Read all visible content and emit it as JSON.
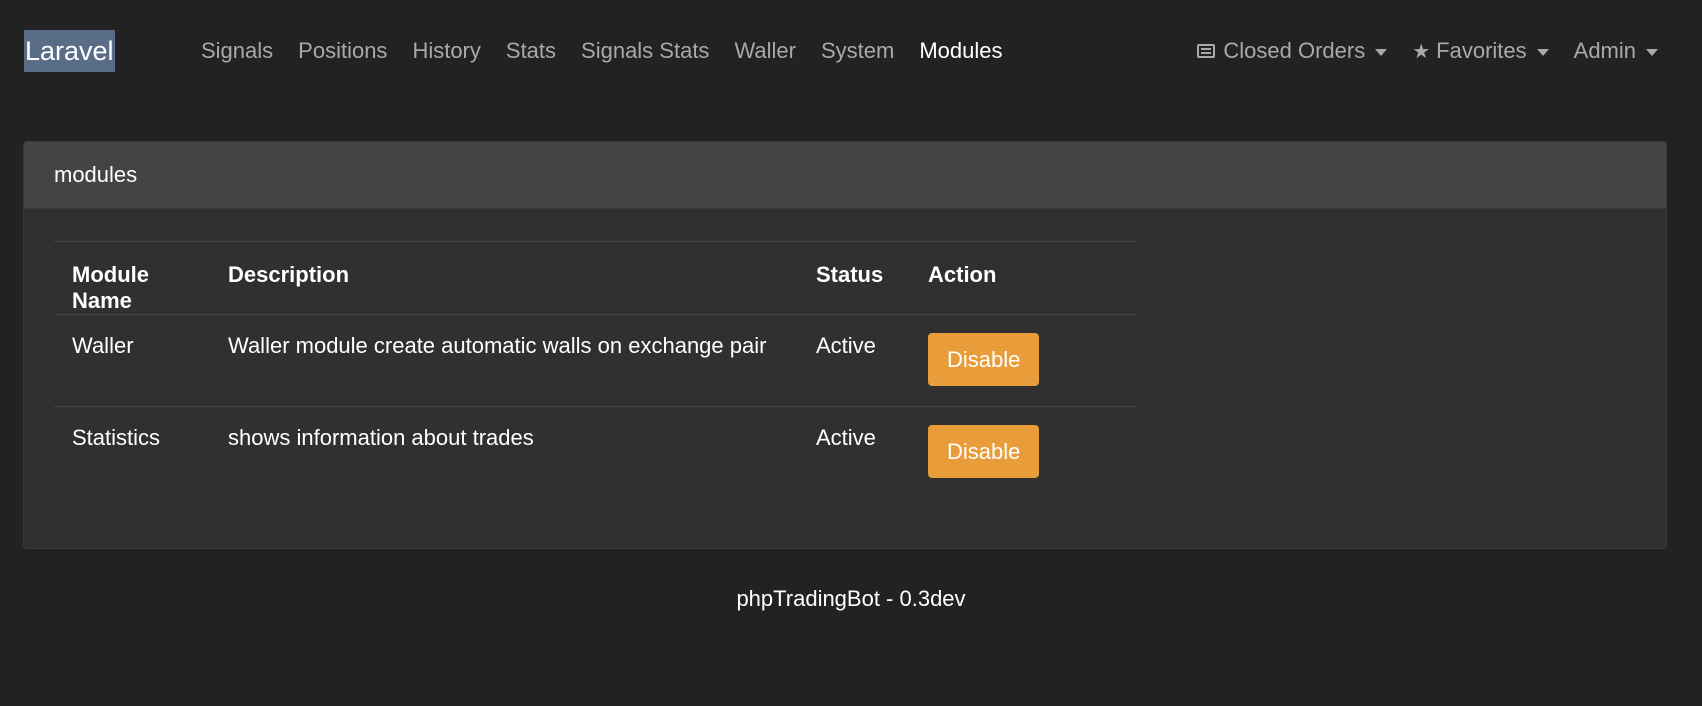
{
  "brand": "Laravel",
  "nav": {
    "links": [
      "Signals",
      "Positions",
      "History",
      "Stats",
      "Signals Stats",
      "Waller",
      "System",
      "Modules"
    ],
    "active": "Modules"
  },
  "nav_right": {
    "closed_orders": {
      "label": "Closed Orders",
      "icon": "list-alt-icon"
    },
    "favorites": {
      "label": "Favorites",
      "icon": "star-icon"
    },
    "admin": {
      "label": "Admin"
    }
  },
  "card": {
    "title": "modules",
    "columns": [
      "Module Name",
      "Description",
      "Status",
      "Action"
    ],
    "rows": [
      {
        "name": "Waller",
        "description": "Waller module create automatic walls on exchange pair",
        "status": "Active",
        "action": "Disable"
      },
      {
        "name": "Statistics",
        "description": "shows information about trades",
        "status": "Active",
        "action": "Disable"
      }
    ]
  },
  "footer": "phpTradingBot - 0.3dev",
  "colors": {
    "background": "#222222",
    "card": "#303030",
    "card_header": "#444444",
    "button_warning": "#e99d3a",
    "nav_muted": "#a9a9a9"
  }
}
